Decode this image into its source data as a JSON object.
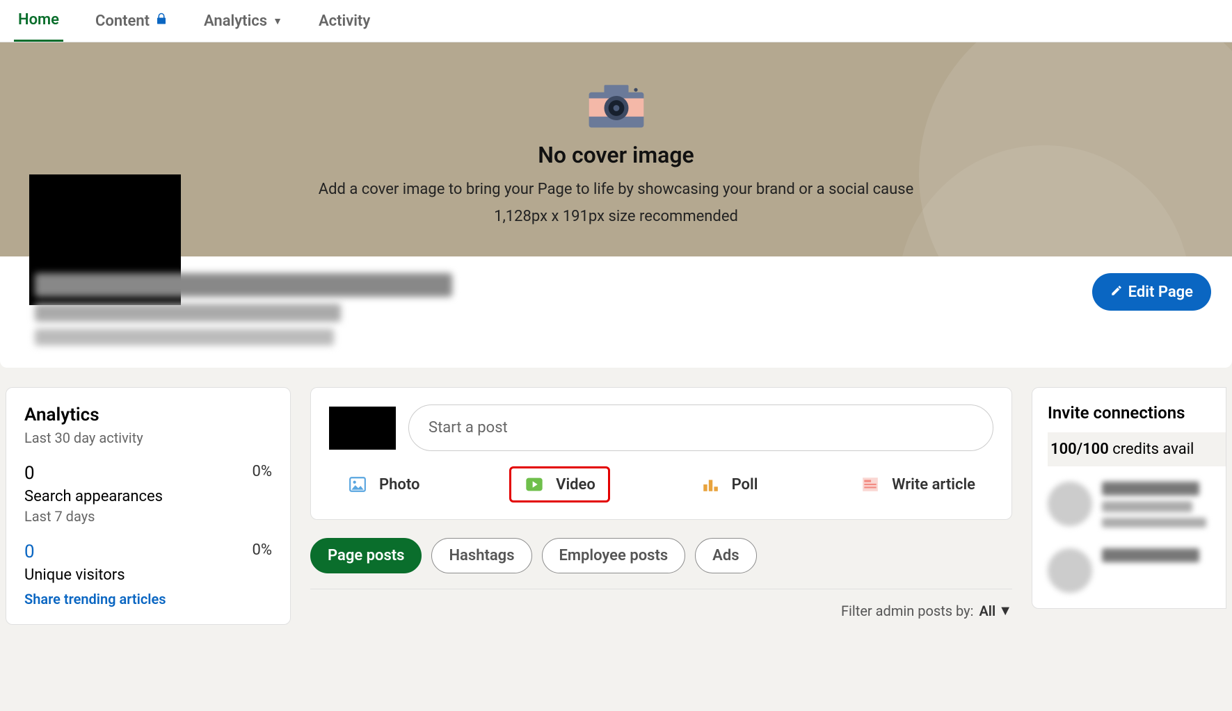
{
  "tabs": {
    "home": "Home",
    "content": "Content",
    "analytics": "Analytics",
    "activity": "Activity"
  },
  "cover": {
    "title": "No cover image",
    "subtitle": "Add a cover image to bring your Page to life by showcasing your brand or a social cause",
    "size_hint": "1,128px x 191px size recommended"
  },
  "edit_page_label": "Edit Page",
  "analytics_card": {
    "title": "Analytics",
    "subtitle": "Last 30 day activity",
    "search": {
      "value": "0",
      "pct": "0%",
      "label": "Search appearances",
      "sub": "Last 7 days"
    },
    "visitors": {
      "value": "0",
      "pct": "0%",
      "label": "Unique visitors"
    },
    "share_link": "Share trending articles"
  },
  "composer": {
    "placeholder": "Start a post",
    "types": {
      "photo": "Photo",
      "video": "Video",
      "poll": "Poll",
      "article": "Write article"
    }
  },
  "post_filters": {
    "page_posts": "Page posts",
    "hashtags": "Hashtags",
    "employee_posts": "Employee posts",
    "ads": "Ads"
  },
  "admin_filter": {
    "label": "Filter admin posts by:",
    "value": "All"
  },
  "invite": {
    "title": "Invite connections",
    "credits_bold": "100/100",
    "credits_rest": " credits avail"
  }
}
